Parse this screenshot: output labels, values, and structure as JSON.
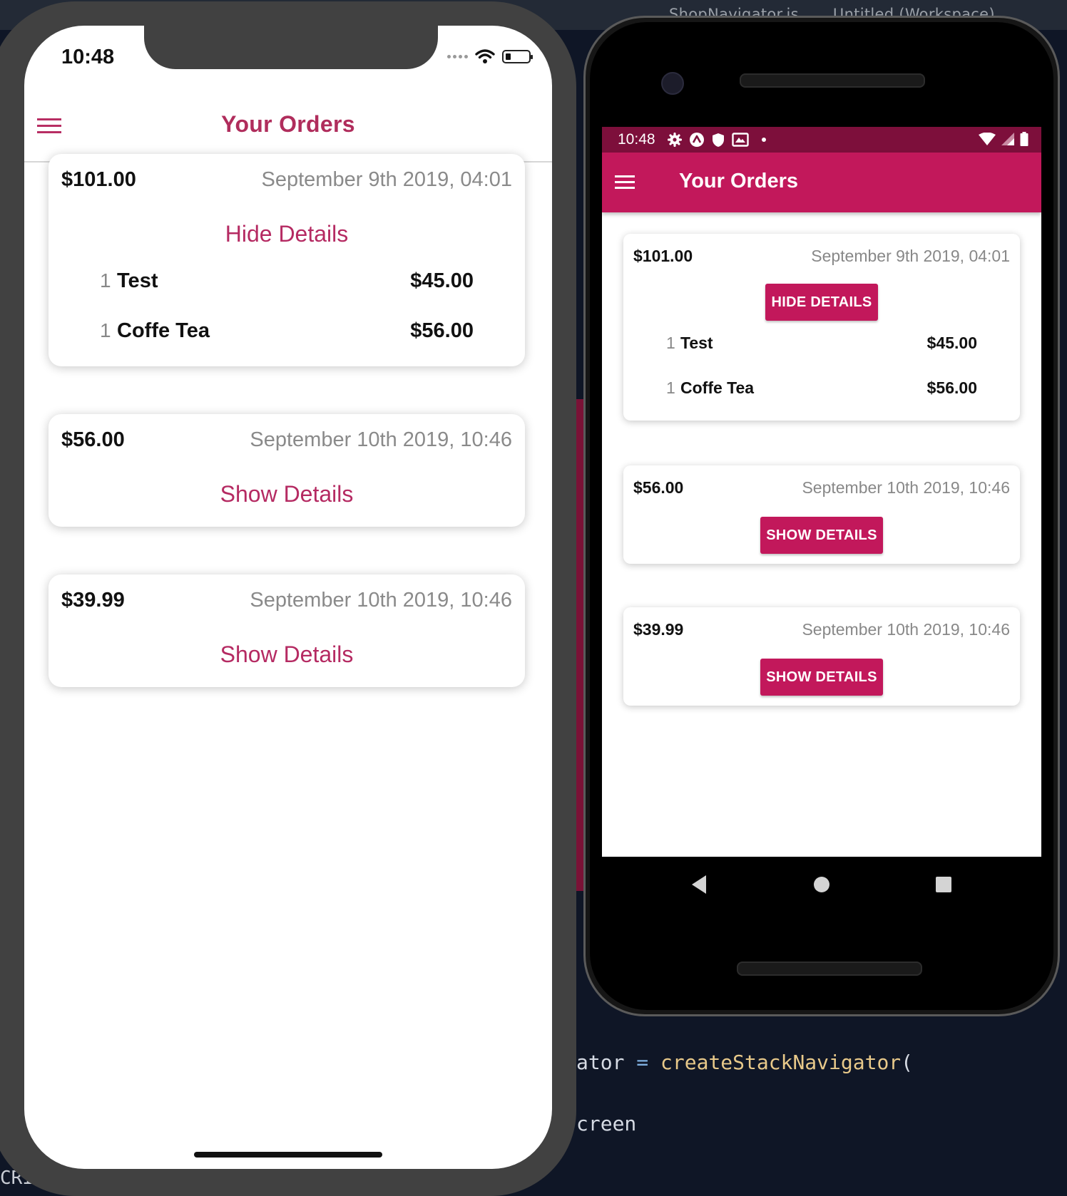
{
  "editor": {
    "title_left": "ShopNavigator.js",
    "title_right": "Untitled (Workspace)",
    "code_line_1": {
      "prefix": "ator",
      "op": "=",
      "fn": "createStackNavigator",
      "paren": "("
    },
    "code_line_2": "creen",
    "bottom_label": "CRIP"
  },
  "ios": {
    "time": "10:48",
    "header_title": "Your Orders",
    "orders": [
      {
        "amount": "$101.00",
        "date": "September 9th 2019, 04:01",
        "toggle_label": "Hide Details",
        "items": [
          {
            "qty": "1",
            "name": "Test",
            "price": "$45.00"
          },
          {
            "qty": "1",
            "name": "Coffe Tea",
            "price": "$56.00"
          }
        ]
      },
      {
        "amount": "$56.00",
        "date": "September 10th 2019, 10:46",
        "toggle_label": "Show Details"
      },
      {
        "amount": "$39.99",
        "date": "September 10th 2019, 10:46",
        "toggle_label": "Show Details"
      }
    ]
  },
  "android": {
    "time": "10:48",
    "header_title": "Your Orders",
    "orders": [
      {
        "amount": "$101.00",
        "date": "September 9th 2019, 04:01",
        "toggle_label": "HIDE DETAILS",
        "items": [
          {
            "qty": "1",
            "name": "Test",
            "price": "$45.00"
          },
          {
            "qty": "1",
            "name": "Coffe Tea",
            "price": "$56.00"
          }
        ]
      },
      {
        "amount": "$56.00",
        "date": "September 10th 2019, 10:46",
        "toggle_label": "SHOW DETAILS"
      },
      {
        "amount": "$39.99",
        "date": "September 10th 2019, 10:46",
        "toggle_label": "SHOW DETAILS"
      }
    ]
  },
  "colors": {
    "accent": "#c2185b",
    "ios_accent": "#b52a62",
    "status_bar": "#7d0f3b"
  }
}
